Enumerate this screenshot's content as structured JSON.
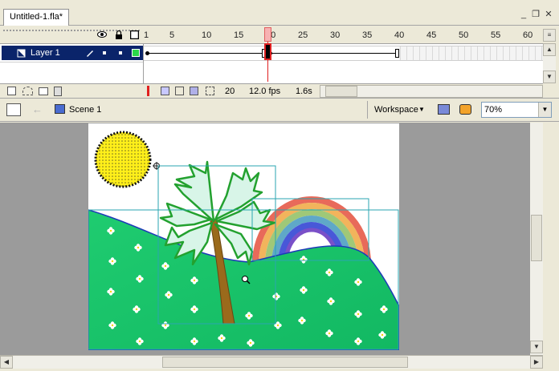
{
  "document": {
    "tab_label": "Untitled-1.fla*"
  },
  "window_controls": {
    "minimize": "_",
    "restore": "❐",
    "close": "✕"
  },
  "timeline": {
    "header_icons": [
      "eye-icon",
      "lock-icon",
      "outline-icon"
    ],
    "ruler": [
      "1",
      "5",
      "10",
      "15",
      "20",
      "25",
      "30",
      "35",
      "40",
      "45",
      "50",
      "55",
      "60"
    ],
    "layer": {
      "name": "Layer 1"
    },
    "current_frame": "20",
    "frame_rate": "12.0 fps",
    "elapsed": "1.6s"
  },
  "editbar": {
    "scene": "Scene 1",
    "workspace": "Workspace",
    "zoom": "70%"
  },
  "colors": {
    "selected_layer": "#0a246a",
    "stage_bg": "#9b9b9b",
    "grass": "#19c46a",
    "sun": "#ffef1a",
    "trunk": "#9a6a1c"
  }
}
